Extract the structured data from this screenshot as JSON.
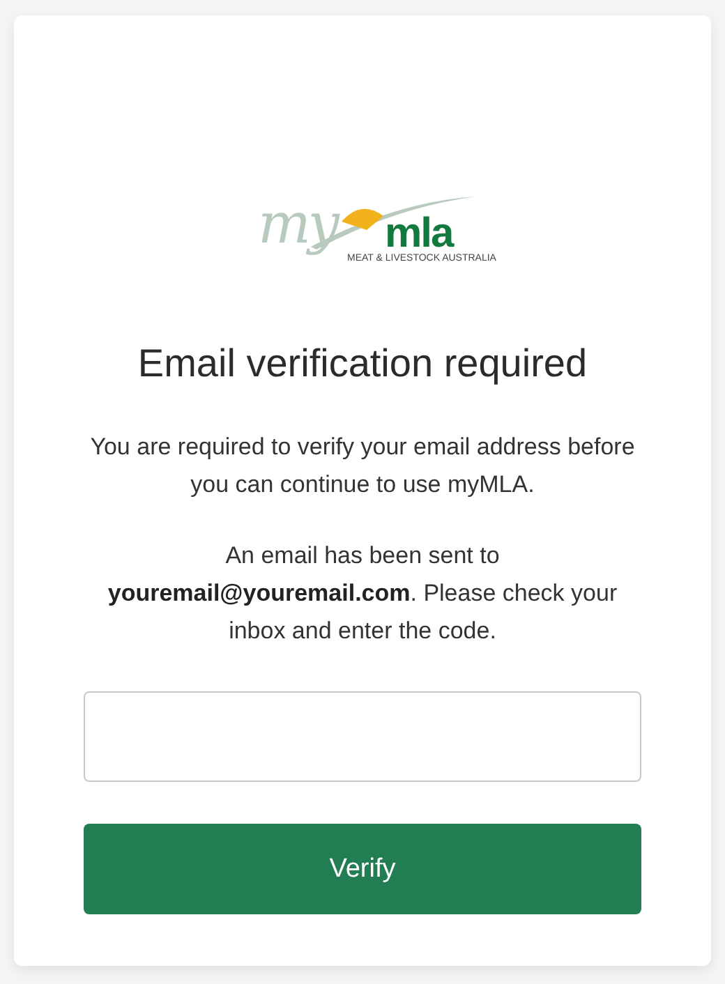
{
  "logo": {
    "script": "my",
    "wordmark": "mla",
    "tagline": "MEAT & LIVESTOCK AUSTRALIA"
  },
  "heading": "Email verification required",
  "paragraphs": [
    "You are required to verify your email address before you can continue to use myMLA.",
    "An email has been sent to **youremail@youremail.com**. Please check your inbox and enter the code."
  ],
  "button": "Verify"
}
